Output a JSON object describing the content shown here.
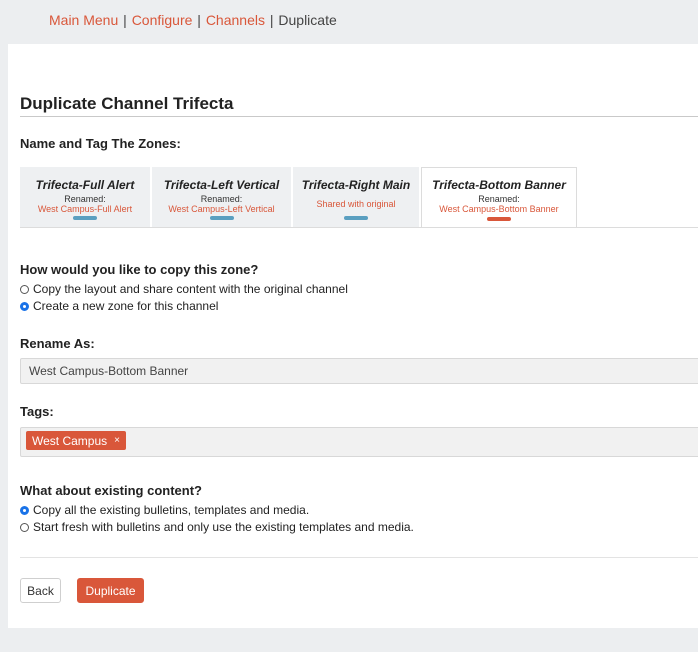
{
  "breadcrumb": {
    "main_menu": "Main Menu",
    "configure": "Configure",
    "channels": "Channels",
    "current": "Duplicate",
    "separator": "|"
  },
  "page": {
    "title": "Duplicate Channel Trifecta"
  },
  "zones": {
    "heading": "Name and Tag The Zones:",
    "tabs": [
      {
        "name": "Trifecta-Full Alert",
        "renamed_label": "Renamed:",
        "status": "West Campus-Full Alert",
        "active": false
      },
      {
        "name": "Trifecta-Left Vertical",
        "renamed_label": "Renamed:",
        "status": "West Campus-Left Vertical",
        "active": false
      },
      {
        "name": "Trifecta-Right Main",
        "status": "Shared with original",
        "active": false
      },
      {
        "name": "Trifecta-Bottom Banner",
        "renamed_label": "Renamed:",
        "status": "West Campus-Bottom Banner",
        "active": true
      }
    ]
  },
  "copy_zone": {
    "question": "How would you like to copy this zone?",
    "options": [
      {
        "label": "Copy the layout and share content with the original channel",
        "checked": false
      },
      {
        "label": "Create a new zone for this channel",
        "checked": true
      }
    ]
  },
  "rename": {
    "label": "Rename As:",
    "value": "West Campus-Bottom Banner"
  },
  "tags": {
    "label": "Tags:",
    "items": [
      {
        "label": "West Campus",
        "remove": "×"
      }
    ]
  },
  "existing_content": {
    "question": "What about existing content?",
    "options": [
      {
        "label": "Copy all the existing bulletins, templates and media.",
        "checked": true
      },
      {
        "label": "Start fresh with bulletins and only use the existing templates and media.",
        "checked": false
      }
    ]
  },
  "actions": {
    "back": "Back",
    "duplicate": "Duplicate"
  },
  "colors": {
    "accent": "#d9573a",
    "tab_bar": "#5a9fc0",
    "radio_selected": "#1a73e8"
  }
}
